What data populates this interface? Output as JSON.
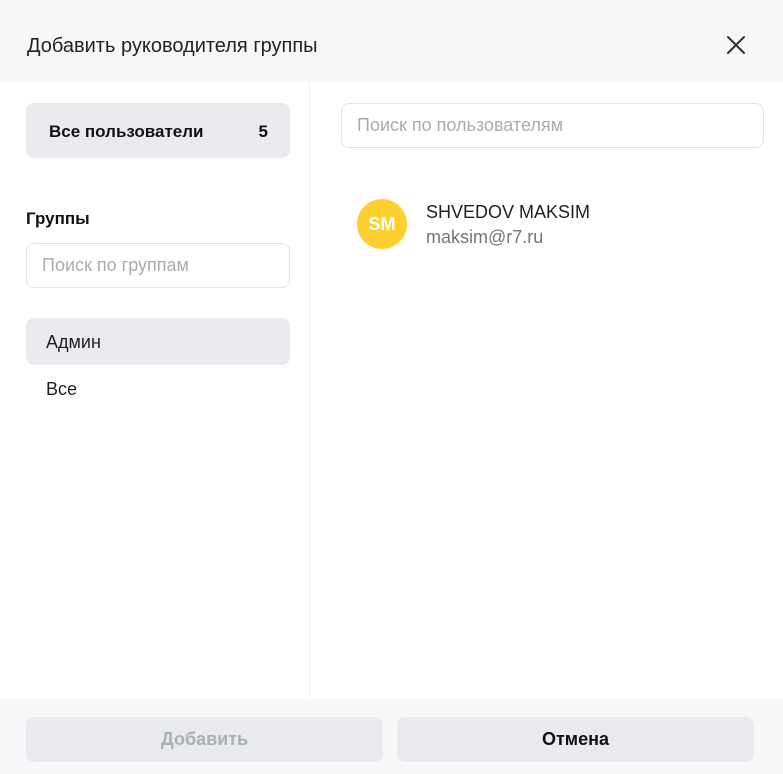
{
  "dialog": {
    "title": "Добавить руководителя группы",
    "close_icon": "close-icon"
  },
  "sidebar": {
    "all_users": {
      "label": "Все пользователи",
      "count": "5"
    },
    "groups_heading": "Группы",
    "group_search": {
      "placeholder": "Поиск по группам",
      "value": ""
    },
    "groups": [
      {
        "label": "Админ",
        "selected": true
      },
      {
        "label": "Все",
        "selected": false
      }
    ]
  },
  "main": {
    "user_search": {
      "placeholder": "Поиск по пользователям",
      "value": ""
    },
    "users": [
      {
        "initials": "SM",
        "name": "SHVEDOV MAKSIM",
        "email": "maksim@r7.ru",
        "avatar_color": "#fdd02f"
      }
    ]
  },
  "footer": {
    "add_label": "Добавить",
    "add_disabled": true,
    "cancel_label": "Отмена"
  },
  "colors": {
    "header_bg": "#f6f7f9",
    "selected_bg": "#e8eaee",
    "avatar": "#fdd02f",
    "muted_text": "#6f7680"
  }
}
